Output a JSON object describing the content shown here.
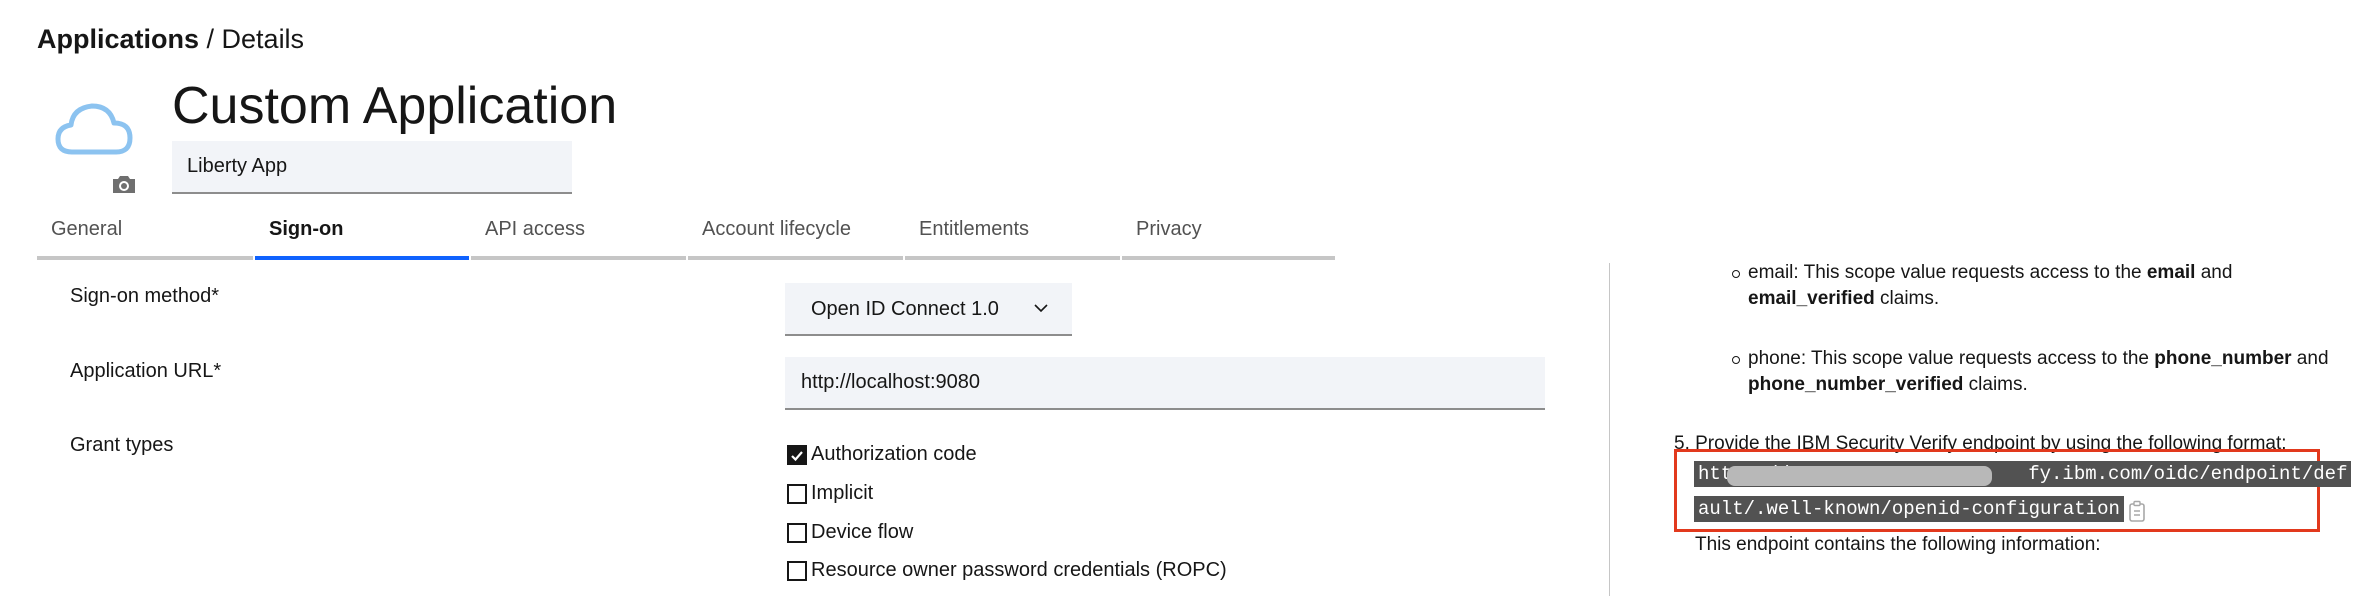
{
  "breadcrumb": {
    "root": "Applications",
    "separator": " / ",
    "current": "Details"
  },
  "app": {
    "title": "Custom Application",
    "name_value": "Liberty App"
  },
  "icons": {
    "app_icon": "cloud-icon",
    "camera": "camera-icon",
    "chevron": "chevron-down-icon",
    "copy": "copy-icon"
  },
  "tabs": [
    {
      "label": "General",
      "active": false
    },
    {
      "label": "Sign-on",
      "active": true
    },
    {
      "label": "API access",
      "active": false
    },
    {
      "label": "Account lifecycle",
      "active": false
    },
    {
      "label": "Entitlements",
      "active": false
    },
    {
      "label": "Privacy",
      "active": false
    }
  ],
  "form": {
    "sign_on_method": {
      "label": "Sign-on method*",
      "value": "Open ID Connect 1.0"
    },
    "application_url": {
      "label": "Application URL*",
      "value": "http://localhost:9080"
    },
    "grant_types": {
      "label": "Grant types",
      "options": [
        {
          "label": "Authorization code",
          "checked": true
        },
        {
          "label": "Implicit",
          "checked": false
        },
        {
          "label": "Device flow",
          "checked": false
        },
        {
          "label": "Resource owner password credentials (ROPC)",
          "checked": false
        }
      ]
    }
  },
  "doc": {
    "email": {
      "prefix": "email: This scope value requests access to the ",
      "bold1": "email",
      "mid": " and",
      "bold2": "email_verified",
      "suffix": " claims."
    },
    "phone": {
      "prefix": "phone: This scope value requests access to the ",
      "bold1": "phone_number",
      "mid": " and",
      "bold2": "phone_number_verified",
      "suffix": " claims."
    },
    "step5": "5. Provide the IBM Security Verify endpoint by using the following format:",
    "endpoint_line1_start": "https://",
    "endpoint_line1_end": "fy.ibm.com/oidc/endpoint/def",
    "endpoint_line2": "ault/.well-known/openid-configuration",
    "info": "This endpoint contains the following information:"
  },
  "colors": {
    "accent": "#0f62fe",
    "highlight_border": "#e2391d",
    "field_bg": "#f2f4f8"
  }
}
